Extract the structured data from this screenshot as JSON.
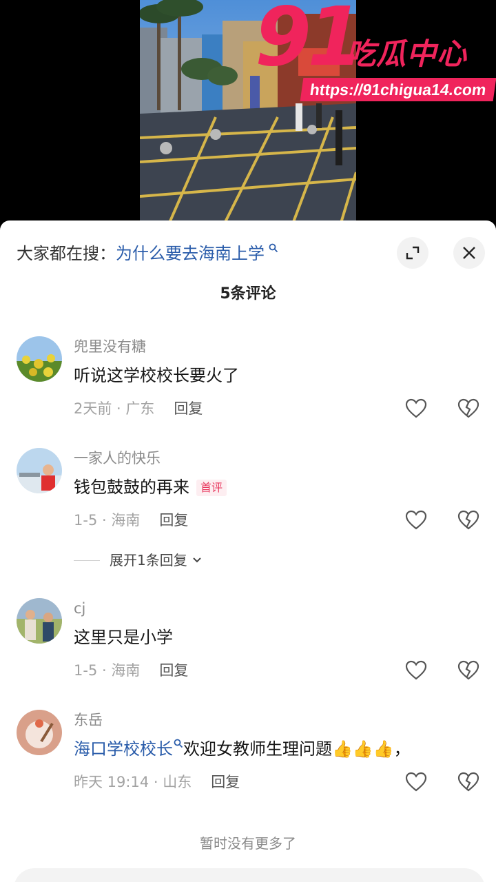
{
  "watermark": {
    "number": "91",
    "name": "吃瓜中心",
    "url": "https://91chigua14.com"
  },
  "sheet": {
    "search_prefix": "大家都在搜：",
    "search_term": "为什么要去海南上学",
    "comment_count": "5条评论",
    "no_more": "暂时没有更多了"
  },
  "comments": [
    {
      "username": "兜里没有糖",
      "text": "听说这学校校长要火了",
      "time_location": "2天前 · 广东",
      "reply": "回复"
    },
    {
      "username": "一家人的快乐",
      "text": "钱包鼓鼓的再来",
      "badge": "首评",
      "time_location": "1-5 · 海南",
      "reply": "回复",
      "expand_replies": "展开1条回复"
    },
    {
      "username": "cj",
      "text": "这里只是小学",
      "time_location": "1-5 · 海南",
      "reply": "回复"
    },
    {
      "username": "东岳",
      "link_text": "海口学校校长",
      "text": "欢迎女教师生理问题",
      "emoji": "👍👍👍，",
      "time_location": "昨天 19:14 · 山东",
      "reply": "回复"
    }
  ],
  "input": {
    "placeholder": "",
    "icons": [
      "at-icon",
      "emoji-icon",
      "image-icon"
    ]
  },
  "colors": {
    "watermark_pink": "#f0245c",
    "link_blue": "#2a5caa",
    "badge_red": "#e8365d"
  }
}
